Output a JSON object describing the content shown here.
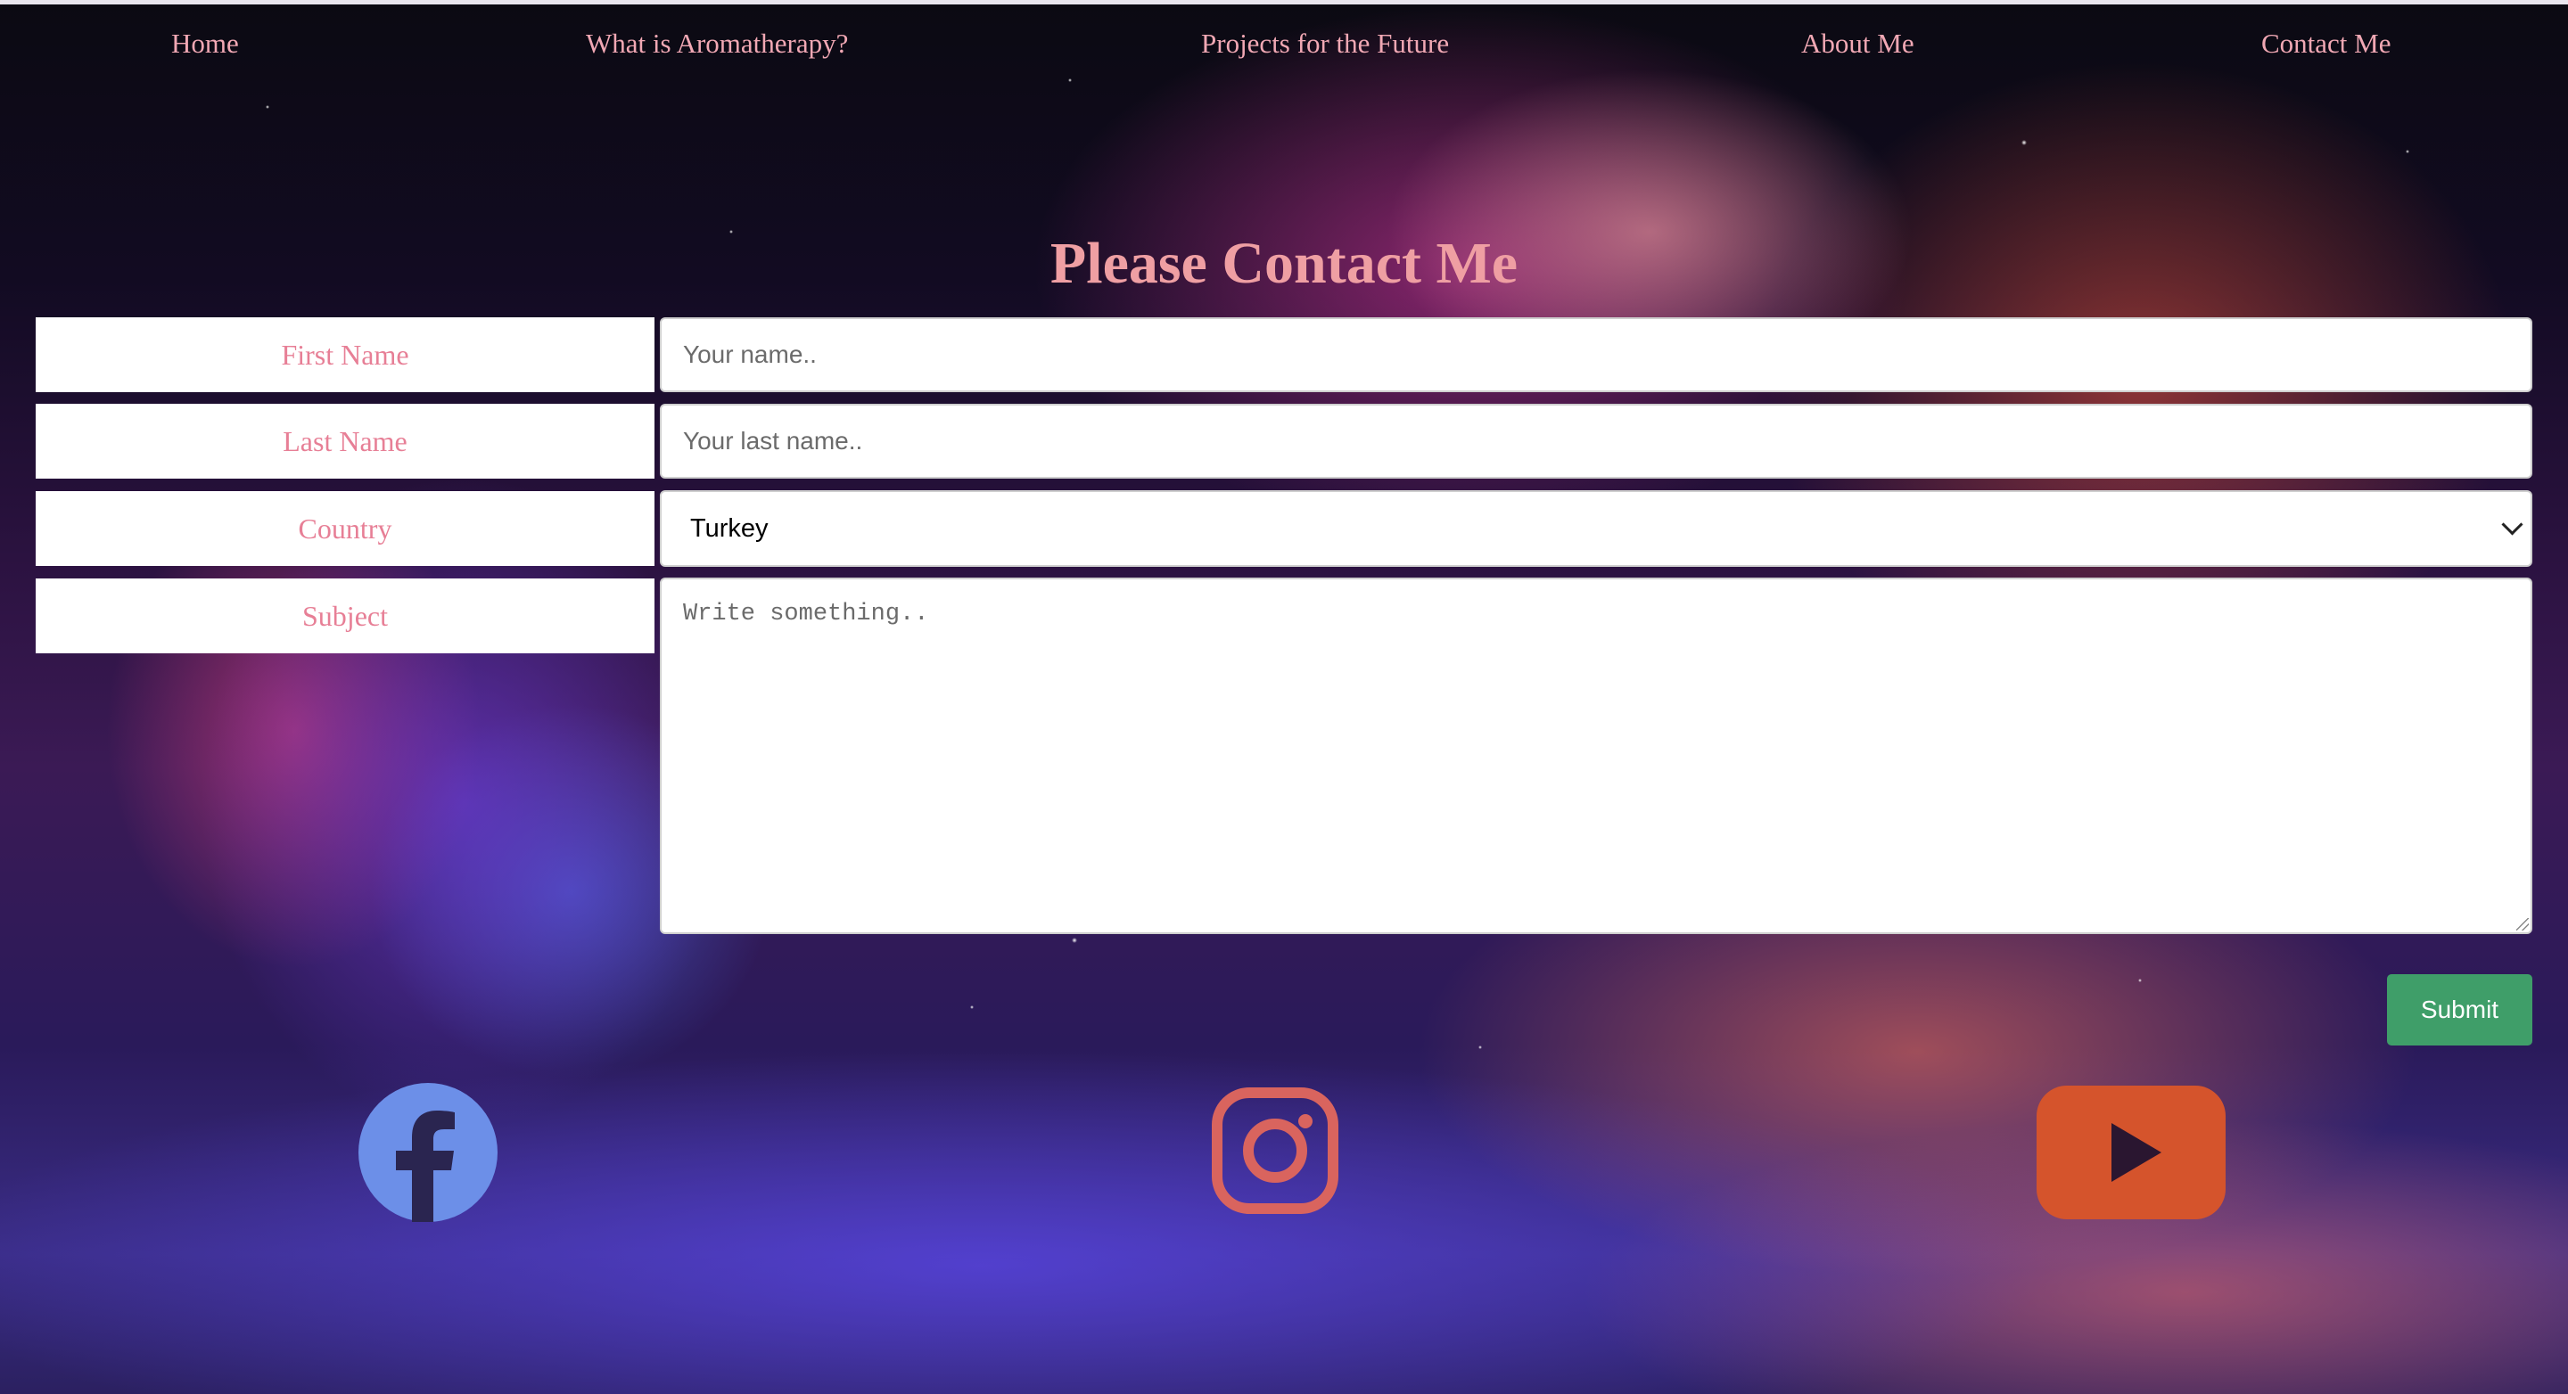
{
  "nav": {
    "items": [
      {
        "label": "Home"
      },
      {
        "label": "What is Aromatherapy?"
      },
      {
        "label": "Projects for the Future"
      },
      {
        "label": "About Me"
      },
      {
        "label": "Contact Me"
      }
    ]
  },
  "page_title": "Please Contact Me",
  "form": {
    "first_name": {
      "label": "First Name",
      "placeholder": "Your name..",
      "value": ""
    },
    "last_name": {
      "label": "Last Name",
      "placeholder": "Your last name..",
      "value": ""
    },
    "country": {
      "label": "Country",
      "selected": "Turkey"
    },
    "subject": {
      "label": "Subject",
      "placeholder": "Write something..",
      "value": ""
    },
    "submit_label": "Submit"
  },
  "social": {
    "icons": [
      {
        "name": "facebook-icon",
        "color": "#6c8fe8"
      },
      {
        "name": "instagram-icon",
        "color": "#d9645e"
      },
      {
        "name": "youtube-icon",
        "color": "#d5542c"
      }
    ]
  },
  "colors": {
    "nav_text": "#f1a8b4",
    "title": "#ef9fa3",
    "label_text": "#e77f96",
    "submit_bg": "#3f9e69"
  }
}
